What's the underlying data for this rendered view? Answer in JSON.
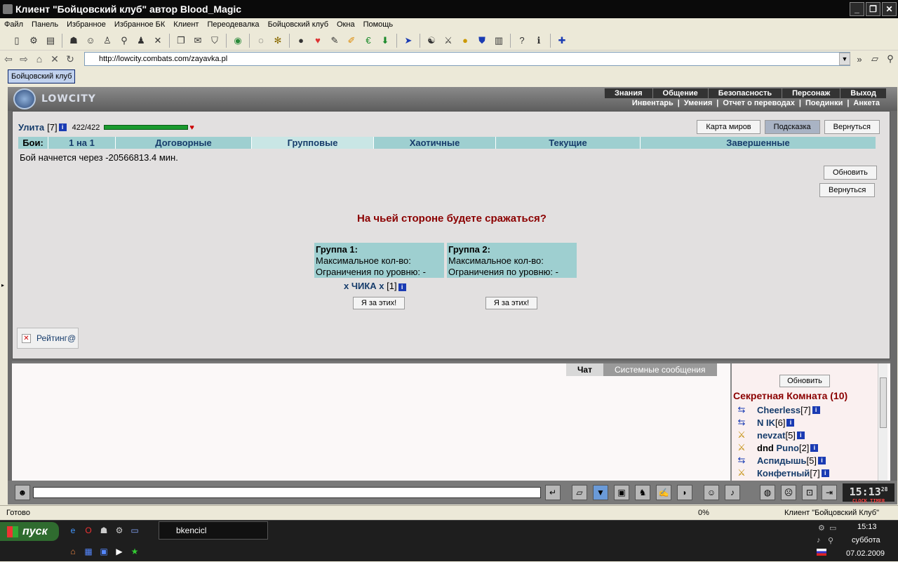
{
  "window": {
    "title": "Клиент \"Бойцовский клуб\" автор Blood_Magic",
    "controls": [
      "_",
      "❐",
      "✕"
    ]
  },
  "menu": [
    "Файл",
    "Панель",
    "Избранное",
    "Избранное БК",
    "Клиент",
    "Переодевалка",
    "Бойцовский клуб",
    "Окна",
    "Помощь"
  ],
  "toolbar_icons": [
    "file-icon",
    "gear-icon",
    "print-icon",
    "mask-icon",
    "user-icon",
    "person-icon",
    "hierarchy-icon",
    "user-search-icon",
    "swords-icon",
    "copy-icon",
    "mail-icon",
    "shield-icon",
    "globe-icon",
    "ring-icon",
    "bug-icon",
    "bomb-icon",
    "heart-icon",
    "scroll-icon",
    "pencil-icon",
    "euro-icon",
    "download-arrow-icon",
    "cursor-icon",
    "yinyang-icon",
    "crossed-swords-icon",
    "medal-icon",
    "guard-icon",
    "book-icon",
    "help-icon",
    "info-icon",
    "puzzle-icon"
  ],
  "address": {
    "url": "http://lowcity.combats.com/zayavka.pl"
  },
  "tab": {
    "label": "Бойцовский клуб"
  },
  "site": {
    "logo": "LOWCITY",
    "topnav": [
      "Знания",
      "Общение",
      "Безопасность",
      "Персонаж",
      "Выход"
    ],
    "subnav": [
      "Инвентарь",
      "Умения",
      "Отчет о переводах",
      "Поединки",
      "Анкета"
    ],
    "divider": "|"
  },
  "player": {
    "name": "Улита",
    "level": "[7]",
    "hp": "422/422",
    "hp_fraction": 1.0
  },
  "buttons": {
    "map": "Карта миров",
    "hint": "Подсказка",
    "back": "Вернуться",
    "refresh": "Обновить",
    "back2": "Вернуться",
    "i_join": "Я за этих!"
  },
  "battle_tabs": {
    "label": "Бои:",
    "items": [
      "1 на 1",
      "Договорные",
      "Групповые",
      "Хаотичные",
      "Текущие",
      "Завершенные"
    ],
    "active": "Групповые"
  },
  "start_message": "Бой начнется через -20566813.4 мин.",
  "question": "На чьей стороне будете сражаться?",
  "groups": [
    {
      "title": "Группа 1:",
      "max": "Максимальное кол-во:",
      "limit": "Ограничения по уровню: -"
    },
    {
      "title": "Группа 2:",
      "max": "Максимальное кол-во:",
      "limit": "Ограничения по уровню: -"
    }
  ],
  "group1_member": {
    "name": "x ЧИКА x",
    "level": "[1]"
  },
  "rating": {
    "label": "Рейтинг@"
  },
  "info_glyph": "i",
  "chat": {
    "tabs": [
      "Чат",
      "Системные сообщения"
    ],
    "active": "Чат"
  },
  "online": {
    "refresh": "Обновить",
    "room": "Секретная Комната (10)",
    "users": [
      {
        "name": "Cheerless",
        "level": "[7]"
      },
      {
        "name": "N IK",
        "level": "[6]"
      },
      {
        "name": "nevzat",
        "level": "[5]"
      },
      {
        "prefix": "dnd",
        "name": "Puno",
        "level": "[2]"
      },
      {
        "name": "Аспидышь",
        "level": "[5]"
      },
      {
        "name": "Конфетный",
        "level": "[7]"
      }
    ]
  },
  "clock": {
    "time": "15:13",
    "seconds": "28",
    "labels": [
      "CLOCK",
      "TIMER"
    ]
  },
  "status": {
    "text": "Готово",
    "progress": "0%",
    "client": "Клиент \"Бойцовский Клуб\""
  },
  "taskbar": {
    "start": "пуск",
    "task": "bkencicl",
    "time": "15:13",
    "day": "суббота",
    "date": "07.02.2009"
  }
}
